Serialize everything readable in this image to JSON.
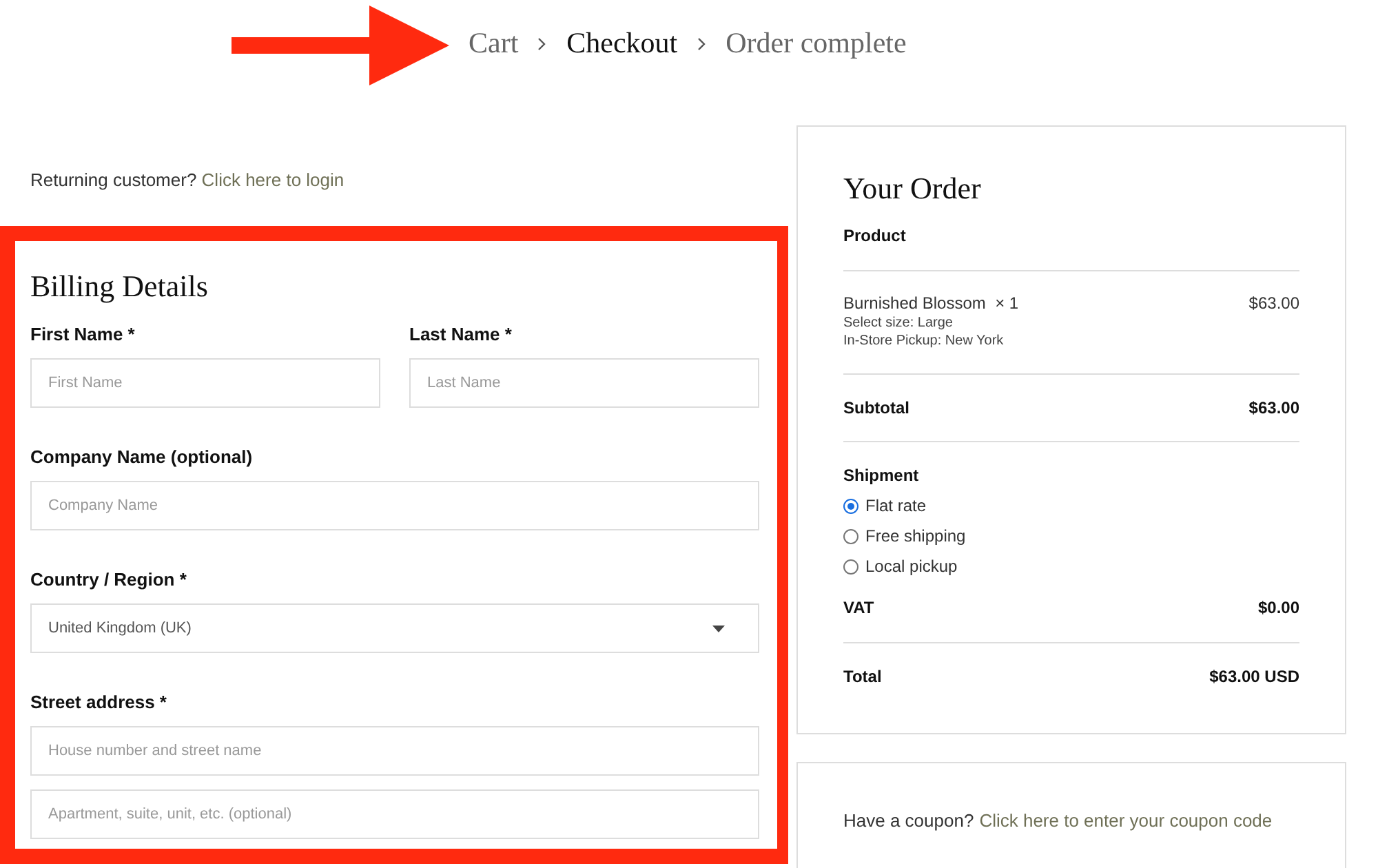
{
  "breadcrumb": {
    "steps": [
      {
        "label": "Cart",
        "selected": false
      },
      {
        "label": "Checkout",
        "selected": true
      },
      {
        "label": "Order complete",
        "selected": false
      }
    ]
  },
  "returning": {
    "text": "Returning customer?",
    "link": "Click here to login"
  },
  "billing": {
    "title": "Billing Details",
    "rows": [
      [
        {
          "kind": "text",
          "label": "First Name *",
          "inputs": [
            {
              "placeholder": "First Name"
            }
          ]
        },
        {
          "kind": "text",
          "label": "Last Name *",
          "inputs": [
            {
              "placeholder": "Last Name"
            }
          ]
        }
      ],
      [
        {
          "kind": "text",
          "label": "Company Name (optional)",
          "inputs": [
            {
              "placeholder": "Company Name"
            }
          ]
        }
      ],
      [
        {
          "kind": "select",
          "label": "Country / Region *",
          "value": "United Kingdom (UK)"
        }
      ],
      [
        {
          "kind": "text",
          "label": "Street address *",
          "inputs": [
            {
              "placeholder": "House number and street name"
            },
            {
              "placeholder": "Apartment, suite, unit, etc. (optional)"
            }
          ]
        }
      ]
    ]
  },
  "order": {
    "title": "Your Order",
    "header": "Product",
    "items": [
      {
        "name": "Burnished Blossom",
        "qty": "× 1",
        "price": "$63.00",
        "details": [
          "Select size: Large",
          "In-Store Pickup: New York"
        ]
      }
    ],
    "subtotal": {
      "label": "Subtotal",
      "value": "$63.00"
    },
    "shipment": {
      "label": "Shipment",
      "options": [
        {
          "label": "Flat rate",
          "selected": true
        },
        {
          "label": "Free shipping",
          "selected": false
        },
        {
          "label": "Local pickup",
          "selected": false
        }
      ]
    },
    "vat": {
      "label": "VAT",
      "value": "$0.00"
    },
    "total": {
      "label": "Total",
      "value": "$63.00 USD"
    }
  },
  "coupon": {
    "text": "Have a coupon?",
    "link": "Click here to enter your coupon code"
  }
}
